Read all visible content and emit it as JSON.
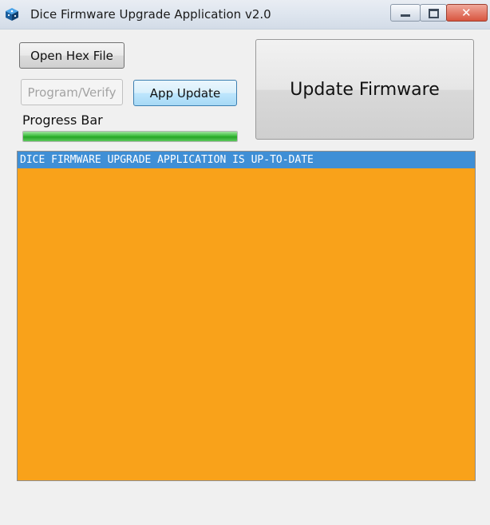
{
  "window": {
    "title": "Dice Firmware Upgrade Application v2.0",
    "icon": "dice-icon",
    "controls": {
      "minimize": "minimize-icon",
      "maximize": "maximize-icon",
      "close": "✕"
    }
  },
  "buttons": {
    "open_hex": "Open Hex File",
    "program_verify": "Program/Verify",
    "app_update": "App Update",
    "update_firmware": "Update Firmware"
  },
  "progress": {
    "label": "Progress Bar",
    "value_percent": 100,
    "color": "#3cbd3c"
  },
  "log": {
    "lines": [
      "DICE FIRMWARE UPGRADE APPLICATION IS UP-TO-DATE"
    ],
    "background": "#f9a21a",
    "highlight": "#3f8fd6"
  }
}
